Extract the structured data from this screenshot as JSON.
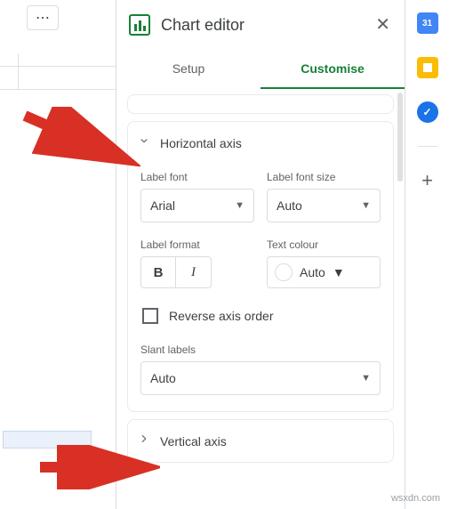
{
  "header": {
    "title": "Chart editor"
  },
  "tabs": {
    "setup": "Setup",
    "customise": "Customise"
  },
  "horizontal_axis": {
    "title": "Horizontal axis",
    "label_font_label": "Label font",
    "label_font_value": "Arial",
    "label_font_size_label": "Label font size",
    "label_font_size_value": "Auto",
    "label_format_label": "Label format",
    "bold_label": "B",
    "italic_label": "I",
    "text_colour_label": "Text colour",
    "text_colour_value": "Auto",
    "reverse_axis_label": "Reverse axis order",
    "slant_labels_label": "Slant labels",
    "slant_labels_value": "Auto"
  },
  "vertical_axis": {
    "title": "Vertical axis"
  },
  "watermark": "wsxdn.com"
}
